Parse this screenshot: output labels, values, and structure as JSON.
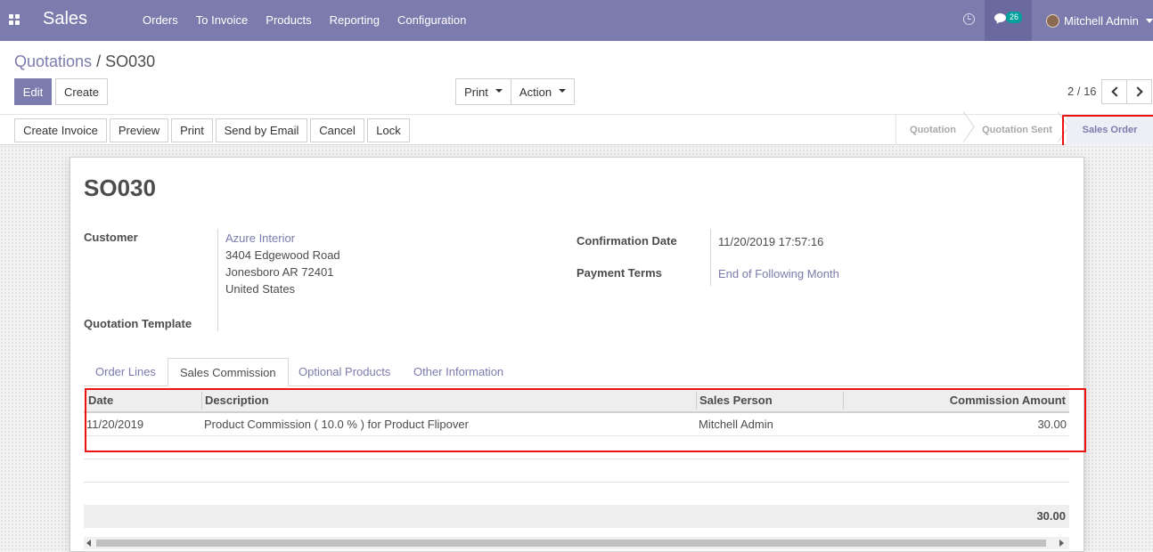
{
  "app": {
    "brand": "Sales",
    "menu": [
      "Orders",
      "To Invoice",
      "Products",
      "Reporting",
      "Configuration"
    ],
    "chat_count": "26",
    "user_name": "Mitchell Admin",
    "accent_color": "#7c7bad"
  },
  "breadcrumb": {
    "parent": "Quotations",
    "separator": "/",
    "current": "SO030"
  },
  "control": {
    "edit": "Edit",
    "create": "Create",
    "print": "Print",
    "action": "Action",
    "pager": "2 / 16"
  },
  "statusbar": {
    "buttons": [
      "Create Invoice",
      "Preview",
      "Print",
      "Send by Email",
      "Cancel",
      "Lock"
    ],
    "stages": [
      "Quotation",
      "Quotation Sent",
      "Sales Order"
    ],
    "active_stage": "Sales Order"
  },
  "form": {
    "title": "SO030",
    "customer_label": "Customer",
    "customer_name": "Azure Interior",
    "address": [
      "3404 Edgewood Road",
      "Jonesboro AR 72401",
      "United States"
    ],
    "template_label": "Quotation Template",
    "template_value": "",
    "confirmation_label": "Confirmation Date",
    "confirmation_value": "11/20/2019 17:57:16",
    "payment_label": "Payment Terms",
    "payment_value": "End of Following Month"
  },
  "tabs": [
    "Order Lines",
    "Sales Commission",
    "Optional Products",
    "Other Information"
  ],
  "active_tab": "Sales Commission",
  "commission_table": {
    "columns": [
      "Date",
      "Description",
      "Sales Person",
      "Commission Amount"
    ],
    "rows": [
      [
        "11/20/2019",
        "Product Commission ( 10.0 % ) for Product Flipover",
        "Mitchell Admin",
        "30.00"
      ]
    ],
    "total": "30.00"
  }
}
